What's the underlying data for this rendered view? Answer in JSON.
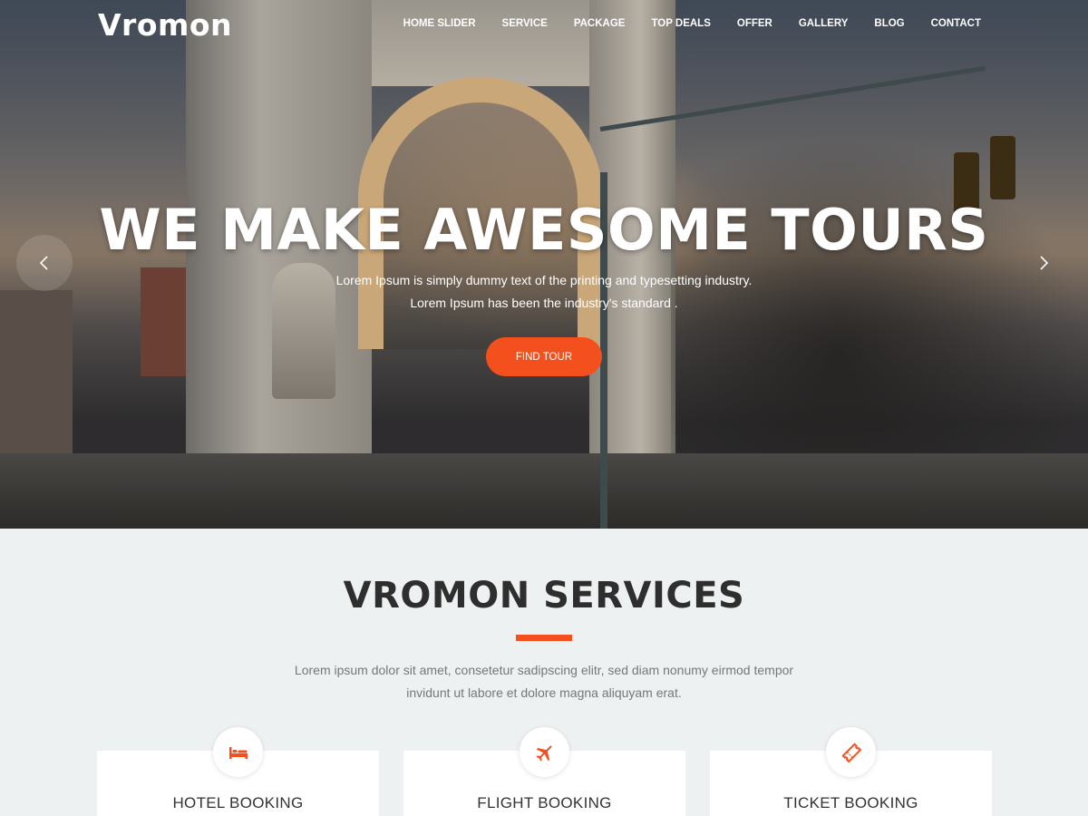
{
  "brand": {
    "logo": "Vromon"
  },
  "nav": {
    "items": [
      {
        "label": "HOME SLIDER"
      },
      {
        "label": "SERVICE"
      },
      {
        "label": "PACKAGE"
      },
      {
        "label": "TOP DEALS"
      },
      {
        "label": "OFFER"
      },
      {
        "label": "GALLERY"
      },
      {
        "label": "BLOG"
      },
      {
        "label": "CONTACT"
      }
    ]
  },
  "hero": {
    "title": "WE MAKE AWESOME TOURS",
    "subtitle_line1": "Lorem Ipsum is simply dummy text of the printing and typesetting industry.",
    "subtitle_line2": "Lorem Ipsum has been the industry's standard .",
    "cta_label": "FIND TOUR",
    "prev_icon": "chevron-left-icon",
    "next_icon": "chevron-right-icon"
  },
  "services": {
    "title": "VROMON SERVICES",
    "desc_line1": "Lorem ipsum dolor sit amet, consetetur sadipscing elitr, sed diam nonumy eirmod tempor",
    "desc_line2": "invidunt ut labore et dolore magna aliquyam erat.",
    "cards": [
      {
        "label": "HOTEL BOOKING",
        "icon": "bed-icon"
      },
      {
        "label": "FLIGHT BOOKING",
        "icon": "plane-icon"
      },
      {
        "label": "TICKET BOOKING",
        "icon": "ticket-icon"
      }
    ]
  },
  "colors": {
    "accent": "#f4501e",
    "section_bg": "#eef1f2",
    "heading": "#2e2e2e",
    "text_muted": "#777777"
  }
}
